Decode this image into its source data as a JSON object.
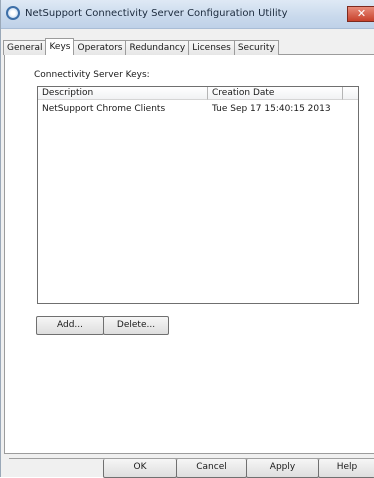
{
  "window": {
    "title": "NetSupport Connectivity Server Configuration Utility",
    "close_glyph": "✕"
  },
  "tabs": [
    {
      "label": "General",
      "active": false
    },
    {
      "label": "Keys",
      "active": true
    },
    {
      "label": "Operators",
      "active": false
    },
    {
      "label": "Redundancy",
      "active": false
    },
    {
      "label": "Licenses",
      "active": false
    },
    {
      "label": "Security",
      "active": false
    }
  ],
  "keys_panel": {
    "section_label": "Connectivity Server Keys:",
    "columns": [
      "Description",
      "Creation Date",
      ""
    ],
    "rows": [
      {
        "description": "NetSupport Chrome Clients",
        "creation_date": "Tue Sep 17 15:40:15 2013"
      }
    ],
    "add_label": "Add...",
    "delete_label": "Delete..."
  },
  "footer": {
    "ok_label": "OK",
    "cancel_label": "Cancel",
    "apply_label": "Apply",
    "help_label": "Help"
  }
}
